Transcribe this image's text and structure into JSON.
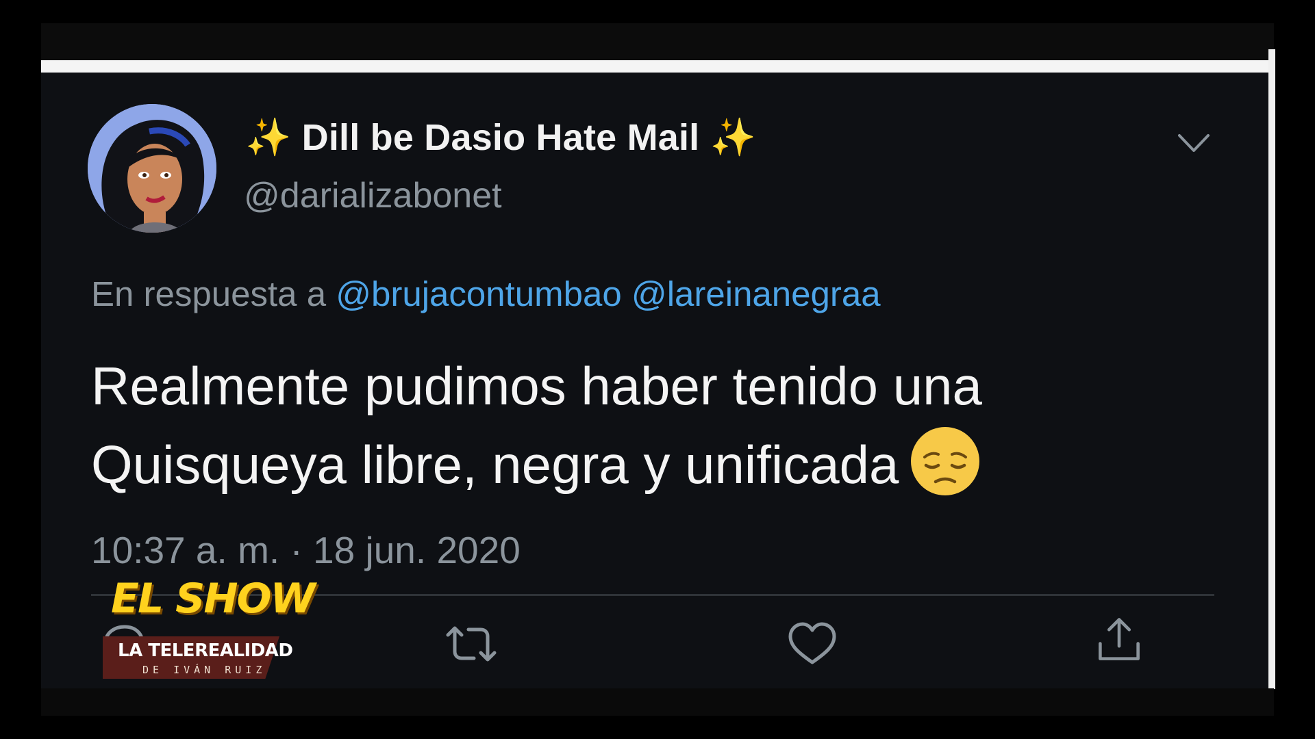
{
  "tweet": {
    "display_name_main": "Dill be Dasio Hate Mail",
    "display_name_emoji_left": "✨",
    "display_name_emoji_right": "✨",
    "handle": "@darializabonet",
    "reply_prefix": "En respuesta a",
    "reply_mentions": [
      "@brujacontumbao",
      "@lareinanegraa"
    ],
    "text_line1": "Realmente pudimos haber tenido una",
    "text_line2": "Quisqueya libre, negra y unificada",
    "text_emoji": "pensive-face",
    "timestamp": "10:37 a. m. · 18 jun. 2020"
  },
  "actions": [
    {
      "icon": "reply-icon"
    },
    {
      "icon": "retweet-icon"
    },
    {
      "icon": "like-icon"
    },
    {
      "icon": "share-icon"
    }
  ],
  "watermark": {
    "title": "EL SHOW",
    "banner": "LA TELEREALIDAD",
    "subtitle": "DE IVÁN RUIZ"
  },
  "colors": {
    "background": "#0e1014",
    "text_primary": "#f4f4f4",
    "text_secondary": "#8b949c",
    "mention": "#4ea5e8",
    "sparkle": "#f5c020"
  }
}
